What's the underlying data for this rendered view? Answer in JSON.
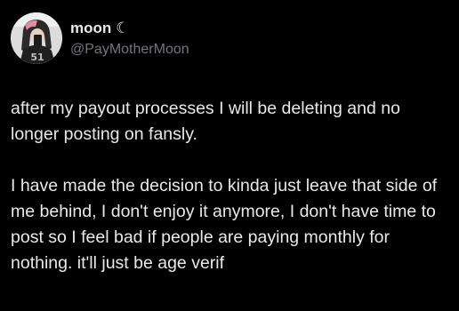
{
  "tweet": {
    "display_name": "moon",
    "badge_icon": "crescent-moon-icon",
    "badge_glyph": "☾",
    "handle": "@PayMotherMoon",
    "paragraphs": [
      "after my payout processes I will be deleting and no longer posting on fansly.",
      "I have made the decision to kinda just leave that side of me behind, I don't enjoy it anymore, I don't have time to post so I feel bad if people are paying monthly for nothing. it'll just be age verif"
    ]
  },
  "colors": {
    "background": "#000000",
    "text_primary": "#e7e9ea",
    "text_secondary": "#71767b"
  }
}
